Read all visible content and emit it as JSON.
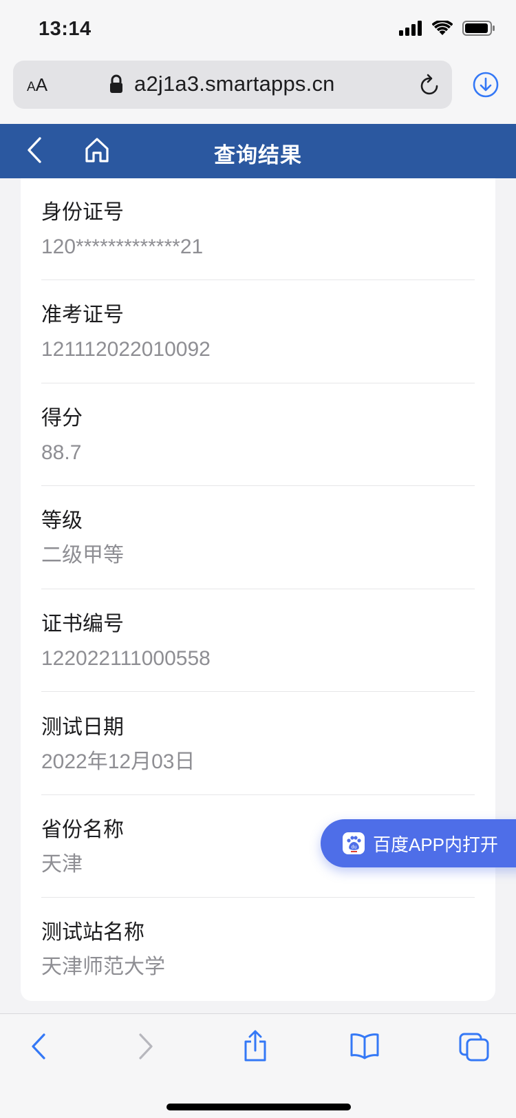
{
  "status_bar": {
    "time": "13:14"
  },
  "browser": {
    "aa_label_small": "A",
    "aa_label_large": "A",
    "url": "a2j1a3.smartapps.cn"
  },
  "header": {
    "title": "查询结果"
  },
  "fields": [
    {
      "label": "身份证号",
      "value": "120*************21"
    },
    {
      "label": "准考证号",
      "value": "121112022010092"
    },
    {
      "label": "得分",
      "value": "88.7"
    },
    {
      "label": "等级",
      "value": "二级甲等"
    },
    {
      "label": "证书编号",
      "value": "122022111000558"
    },
    {
      "label": "测试日期",
      "value": "2022年12月03日"
    },
    {
      "label": "省份名称",
      "value": "天津"
    },
    {
      "label": "测试站名称",
      "value": "天津师范大学"
    }
  ],
  "baidu_button": {
    "label": "百度APP内打开",
    "logo_text": "du"
  },
  "colors": {
    "header": "#2b58a0",
    "accent": "#4e6ee8",
    "ios_blue": "#3478f6"
  }
}
